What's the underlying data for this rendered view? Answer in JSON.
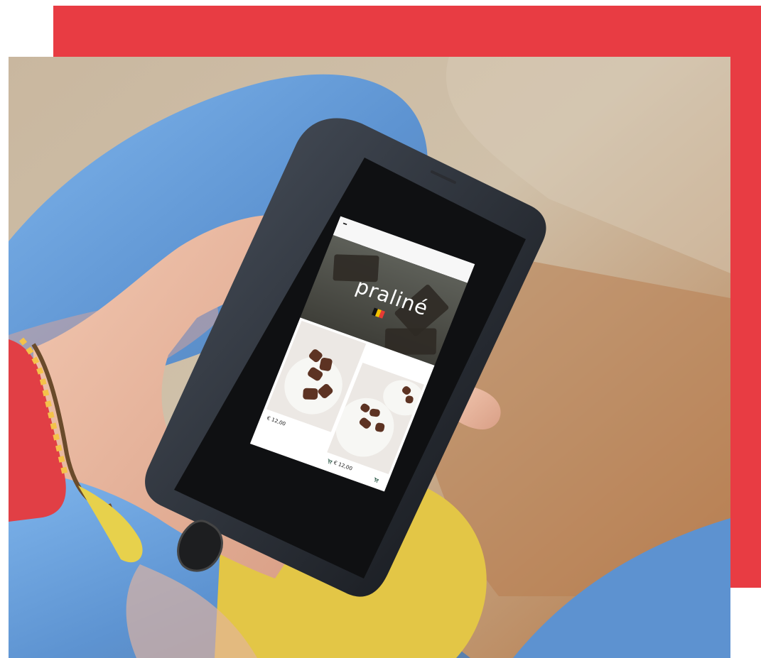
{
  "scene": {
    "description_free": true
  },
  "app": {
    "brand_name": "praliné",
    "flag": [
      "#111111",
      "#f2c100",
      "#e53b35"
    ],
    "products": [
      {
        "price": "€ 12,00"
      },
      {
        "price": "€ 12,00"
      }
    ],
    "icons": {
      "menu": "menu-icon",
      "cart": "cart-icon"
    }
  },
  "colors": {
    "frame_red": "#e83c43",
    "cart_green": "#1e4f3c"
  }
}
